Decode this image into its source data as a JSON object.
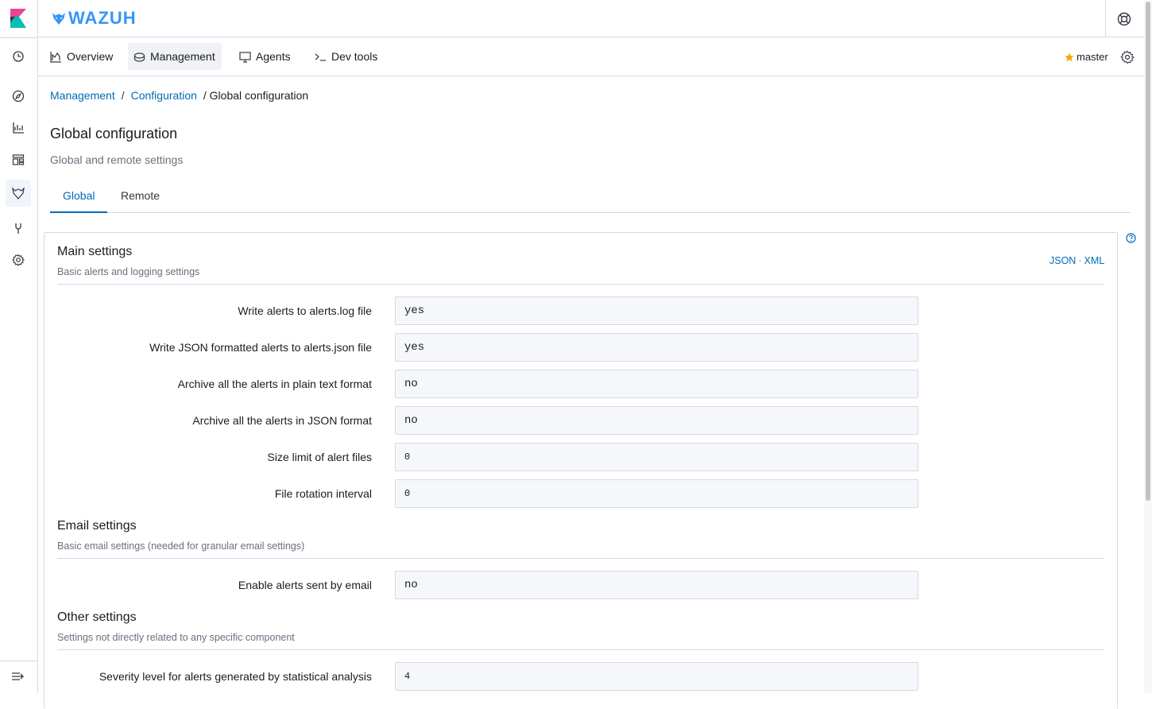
{
  "brand": {
    "name": "WAZUH",
    "color": "#3595f9"
  },
  "nav": {
    "tabs": [
      {
        "label": "Overview",
        "icon": "visualize-icon"
      },
      {
        "label": "Management",
        "icon": "stack-icon",
        "active": true
      },
      {
        "label": "Agents",
        "icon": "monitor-icon"
      },
      {
        "label": "Dev tools",
        "icon": "console-icon"
      }
    ],
    "cluster_node": "master"
  },
  "breadcrumb": {
    "items": [
      "Management",
      "Configuration"
    ],
    "current": "/ Global configuration"
  },
  "page": {
    "title": "Global configuration",
    "subtitle": "Global and remote settings"
  },
  "tabs": [
    "Global",
    "Remote"
  ],
  "panel": {
    "format_links": {
      "json": "JSON",
      "dot": "·",
      "xml": "XML"
    },
    "sections": [
      {
        "title": "Main settings",
        "subtitle": "Basic alerts and logging settings",
        "rows": [
          {
            "label": "Write alerts to alerts.log file",
            "value": "yes"
          },
          {
            "label": "Write JSON formatted alerts to alerts.json file",
            "value": "yes"
          },
          {
            "label": "Archive all the alerts in plain text format",
            "value": "no"
          },
          {
            "label": "Archive all the alerts in JSON format",
            "value": "no"
          },
          {
            "label": "Size limit of alert files",
            "value": "0"
          },
          {
            "label": "File rotation interval",
            "value": "0"
          }
        ]
      },
      {
        "title": "Email settings",
        "subtitle": "Basic email settings (needed for granular email settings)",
        "rows": [
          {
            "label": "Enable alerts sent by email",
            "value": "no"
          }
        ]
      },
      {
        "title": "Other settings",
        "subtitle": "Settings not directly related to any specific component",
        "rows": [
          {
            "label": "Severity level for alerts generated by statistical analysis",
            "value": "4"
          }
        ]
      }
    ]
  },
  "colors": {
    "link": "#006bb4",
    "star": "#f5a700",
    "border": "#d3dae6"
  }
}
